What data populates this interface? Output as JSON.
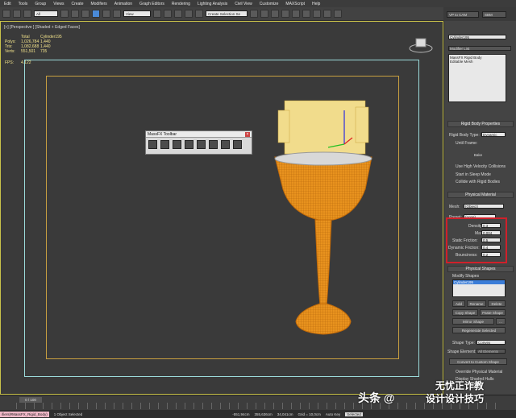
{
  "menu": [
    "Edit",
    "Tools",
    "Group",
    "Views",
    "Create",
    "Modifiers",
    "Animation",
    "Graph Editors",
    "Rendering",
    "Lighting Analysis",
    "Civil View",
    "Customize",
    "MAXScript",
    "Help"
  ],
  "toolbar": {
    "filter": "All",
    "view": "View",
    "selection_set": "Create Selection Se"
  },
  "right_top": {
    "btn1": "VP to CAM",
    "btn2": "SBM"
  },
  "viewport": {
    "label": "[+] [Perspective ] [Shaded + Edged Faces]",
    "stats_header": {
      "total": "Total",
      "object": "Cylinder195"
    },
    "polys": {
      "label": "Polys:",
      "total": "1,026,784",
      "object": "1,440"
    },
    "tris": {
      "label": "Tris:",
      "total": "1,082,688",
      "object": "1,440"
    },
    "verts": {
      "label": "Verts:",
      "total": "551,501",
      "object": "735"
    },
    "fps": {
      "label": "FPS:",
      "value": "4.122"
    }
  },
  "massfx": {
    "title": "MassFX Toolbar"
  },
  "panel": {
    "object_name": "Cylinder195",
    "modifier_list": "Modifier List",
    "stack": [
      "MassFX Rigid Body",
      "Editable Mesh"
    ],
    "rb_props_header": "Rigid Body Properties",
    "rb_type_label": "Rigid Body Type:",
    "rb_type": "Dynamic",
    "until_frame": "Until Frame:",
    "bake": "Bake",
    "use_high_vel": "Use High Velocity Collisions",
    "start_sleep": "Start in Sleep Mode",
    "collide_rb": "Collide with Rigid Bodies",
    "phys_mat_header": "Physical Material",
    "mesh_label": "Mesh:",
    "mesh": "(Object)",
    "preset_label": "Preset:",
    "preset": "(none)",
    "density": {
      "label": "Density:",
      "value": "0,3"
    },
    "mass": {
      "label": "Mass:",
      "value": "0,004"
    },
    "static_friction": {
      "label": "Static Friction:",
      "value": "0,5"
    },
    "dynamic_friction": {
      "label": "Dynamic Friction:",
      "value": "0,4"
    },
    "bounciness": {
      "label": "Bounciness:",
      "value": "0,2"
    },
    "phys_shapes_header": "Physical Shapes",
    "modify_shapes": "Modify Shapes",
    "shape_item": "Cylinder195",
    "add": "Add",
    "rename": "Rename",
    "delete": "Delete",
    "copy_shape": "Copy Shape",
    "paste_shape": "Paste Shape",
    "mirror_shape": "Mirror Shape",
    "mirror_more": "...",
    "regen": "Regenerate Selected",
    "shape_type_label": "Shape Type:",
    "shape_type": "Convex",
    "shape_element_label": "Shape Element:",
    "shape_element": "All Elements",
    "convert_custom": "Convert to Custom Shape",
    "override_mat": "Override Physical Material",
    "display_shaded": "Display Shaded Hulls"
  },
  "timeline": {
    "frame": "0 / 100"
  },
  "status": {
    "script": "ifiers|#MassFX_Rigid_Body)",
    "selected": "1 Object Selected",
    "x": "-551,94cm",
    "y": "355,636cm",
    "z": "34,041cm",
    "grid": "Grid = 10,0cm",
    "autokey": "Auto Key",
    "selected_drop": "Selected"
  },
  "watermark": {
    "left": "头条 @",
    "middle": "设计设计技巧",
    "right": "无忧正诈教"
  }
}
